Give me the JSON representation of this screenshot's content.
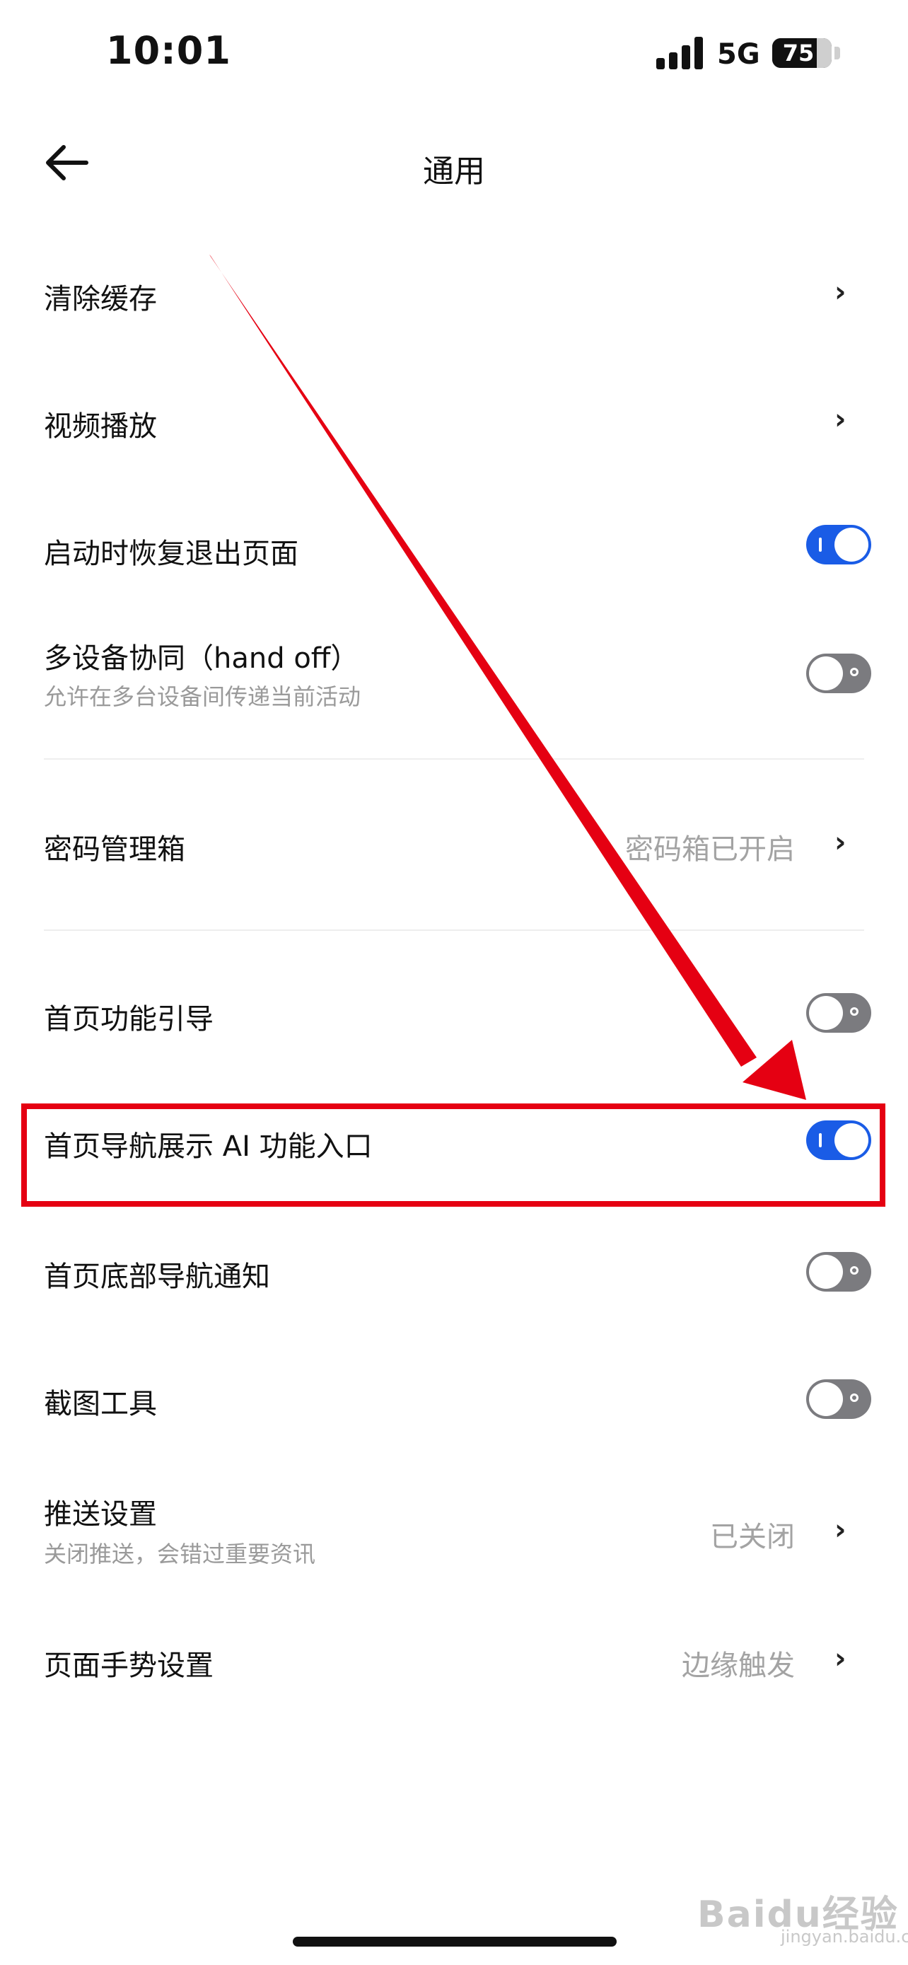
{
  "status_bar": {
    "time": "10:01",
    "network": "5G",
    "battery": "75",
    "battery_level": 0.75
  },
  "header": {
    "title": "通用"
  },
  "settings": {
    "clear_cache": {
      "label": "清除缓存"
    },
    "video_playback": {
      "label": "视频播放"
    },
    "restore_pages": {
      "label": "启动时恢复退出页面",
      "enabled": true
    },
    "handoff": {
      "label": "多设备协同（hand off）",
      "subtitle": "允许在多台设备间传递当前活动",
      "enabled": false
    },
    "password_manager": {
      "label": "密码管理箱",
      "value": "密码箱已开启"
    },
    "home_guide": {
      "label": "首页功能引导",
      "enabled": false
    },
    "home_ai_entry": {
      "label": "首页导航展示 AI 功能入口",
      "enabled": true
    },
    "bottom_nav_notice": {
      "label": "首页底部导航通知",
      "enabled": false
    },
    "screenshot_tool": {
      "label": "截图工具",
      "enabled": false
    },
    "push": {
      "label": "推送设置",
      "subtitle": "关闭推送，会错过重要资讯",
      "value": "已关闭"
    },
    "gesture": {
      "label": "页面手势设置",
      "value": "边缘触发"
    }
  },
  "annotation": {
    "color": "#e50012"
  },
  "colors": {
    "toggle_on": "#1a5ce6",
    "toggle_off": "#7b7b7f"
  },
  "watermark": {
    "brand": "Baidu经验",
    "domain": "jingyan.baidu.com"
  }
}
